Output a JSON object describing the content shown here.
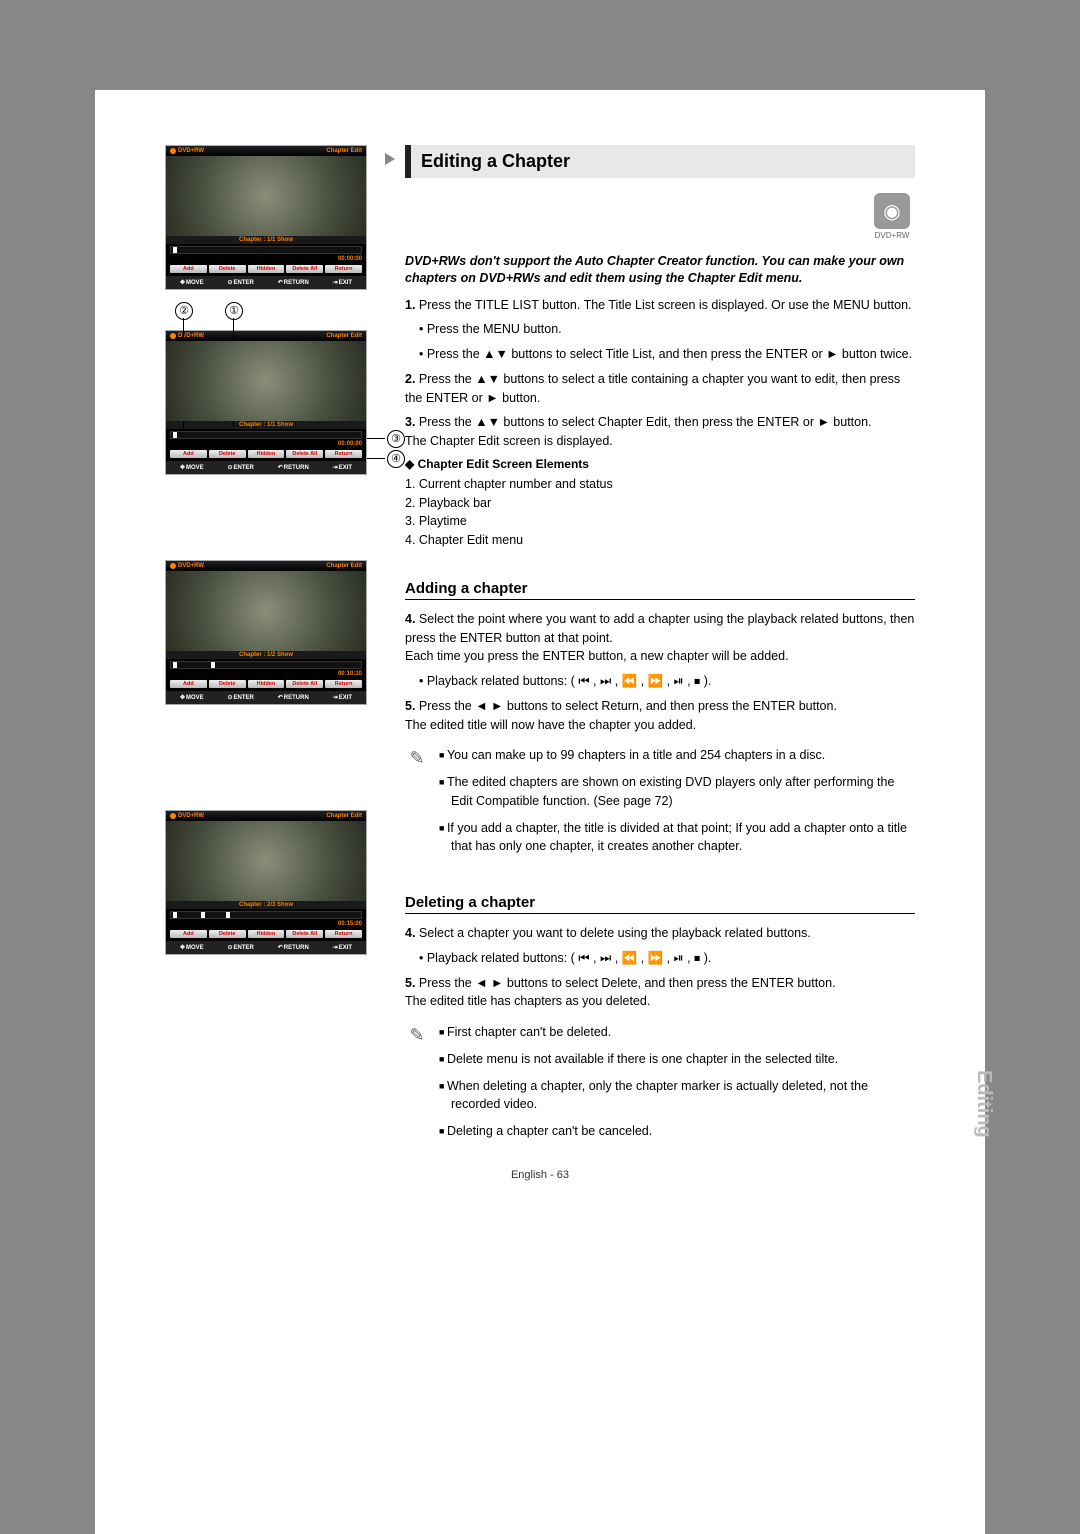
{
  "page": {
    "title": "Editing a Chapter",
    "disc_icon_label": "DVD+RW",
    "intro": "DVD+RWs don't support the Auto Chapter Creator function. You can make your own chapters on DVD+RWs and edit them using the Chapter Edit menu.",
    "steps": [
      {
        "n": "1.",
        "text": "Press the TITLE LIST button. The Title List screen is displayed. Or use the MENU button."
      },
      {
        "n": "",
        "text": "• Press the MENU button.",
        "sub": true
      },
      {
        "n": "",
        "text": "• Press the ▲▼ buttons to select Title List, and then press the ENTER or ► button twice.",
        "sub": true
      },
      {
        "n": "2.",
        "text": "Press the ▲▼ buttons to select a title containing a chapter you want to edit, then press the ENTER or ► button."
      },
      {
        "n": "3.",
        "text": "Press the ▲▼ buttons to select Chapter Edit, then press the ENTER or ► button.\nThe Chapter Edit screen is displayed."
      }
    ],
    "screen_elements_head": "Chapter Edit Screen Elements",
    "screen_elements": [
      "1. Current chapter number and status",
      "2. Playback bar",
      "3. Playtime",
      "4. Chapter Edit menu"
    ],
    "adding_head": "Adding a chapter",
    "adding_steps": [
      {
        "n": "4.",
        "text": "Select the point where you want to add a chapter using the playback related buttons, then press the ENTER button at that point.\nEach time you press the ENTER button, a new chapter will be added."
      },
      {
        "n": "",
        "text": "• Playback related buttons: ( ⏮ , ⏭ , ⏪ , ⏩ , ⏯ , ⏹ ).",
        "sub": true
      },
      {
        "n": "5.",
        "text": "Press the ◄ ► buttons to select Return, and then press the ENTER button.\nThe edited title will now have the chapter you added."
      }
    ],
    "adding_notes": [
      "You can make up to 99 chapters in a title and 254 chapters in a disc.",
      "The edited chapters are shown on existing DVD players only after performing the Edit Compatible function. (See page 72)",
      "If you add a chapter, the title is divided at that point; If you add a chapter onto a title that has only one chapter, it creates another chapter."
    ],
    "deleting_head": "Deleting a chapter",
    "deleting_steps": [
      {
        "n": "4.",
        "text": "Select a chapter you want to delete using the playback related buttons."
      },
      {
        "n": "",
        "text": "• Playback related buttons: ( ⏮ , ⏭ , ⏪ , ⏩ , ⏯ , ⏹ ).",
        "sub": true
      },
      {
        "n": "5.",
        "text": "Press the ◄ ►  buttons to select  Delete, and then press the ENTER button.\nThe edited title has chapters as you deleted."
      }
    ],
    "deleting_notes": [
      "First chapter can't be deleted.",
      "Delete menu is not available if there is one chapter in the selected tilte.",
      "When deleting a chapter, only the chapter marker is actually deleted, not the recorded video.",
      "Deleting a chapter can't be canceled."
    ],
    "side_tab": "Editing",
    "footer": "English - 63"
  },
  "screenshots": {
    "disc": "DVD+RW",
    "title": "Chapter Edit",
    "buttons": [
      "Add",
      "Delete",
      "Hidden",
      "Delete All",
      "Return"
    ],
    "nav": [
      "MOVE",
      "ENTER",
      "RETURN",
      "EXIT"
    ],
    "callouts": {
      "top_left": "②",
      "top_right": "①",
      "right_top": "③",
      "right_bot": "④"
    },
    "s1": {
      "chapter": "Chapter : 1/1 Show",
      "time": "00:00:00"
    },
    "s2": {
      "chapter": "Chapter : 1/1 Show",
      "time": "00:00:00"
    },
    "s3": {
      "chapter": "Chapter : 1/2 Show",
      "time": "00:10:10"
    },
    "s4": {
      "chapter": "Chapter : 2/3 Show",
      "time": "00:15:00"
    }
  }
}
